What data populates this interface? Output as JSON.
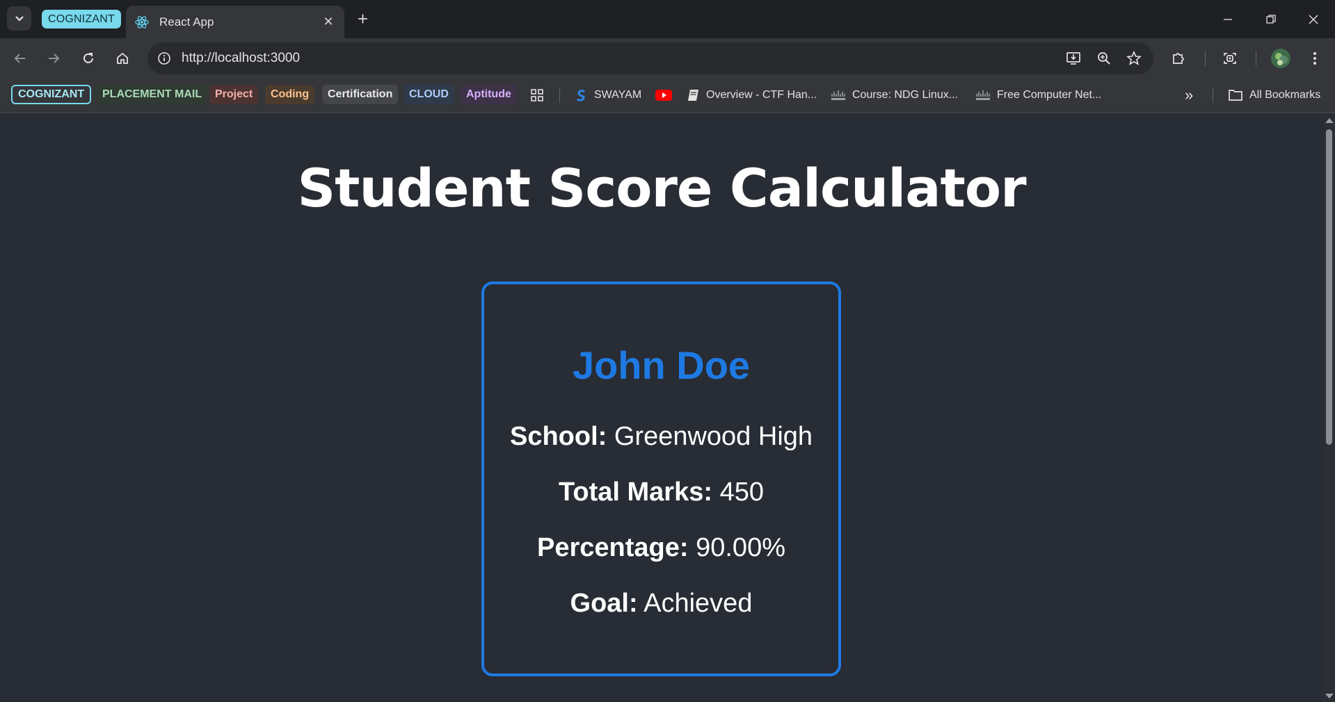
{
  "tab_group": {
    "label": "COGNIZANT"
  },
  "tab": {
    "title": "React App",
    "close": "✕"
  },
  "new_tab": "+",
  "address_bar": {
    "url": "http://localhost:3000"
  },
  "bookmarks": {
    "chips": [
      {
        "label": "COGNIZANT",
        "color": "#78d9ec"
      },
      {
        "label": "PLACEMENT MAIL",
        "color": "#a8dab5"
      },
      {
        "label": "Project",
        "color": "#f28b82"
      },
      {
        "label": "Coding",
        "color": "#fcad70"
      },
      {
        "label": "Certification",
        "color": "#dadce0"
      },
      {
        "label": "CLOUD",
        "color": "#8ab4f8"
      },
      {
        "label": "Aptitude",
        "color": "#c58af9"
      }
    ],
    "links": [
      {
        "label": "SWAYAM"
      },
      {
        "label": ""
      },
      {
        "label": "Overview - CTF Han..."
      },
      {
        "label": "Course: NDG Linux..."
      },
      {
        "label": "Free Computer Net..."
      }
    ],
    "overflow": "»",
    "all_bookmarks": "All Bookmarks"
  },
  "page": {
    "heading": "Student Score Calculator",
    "student": {
      "name": "John Doe",
      "school_label": "School:",
      "school": "Greenwood High",
      "total_label": "Total Marks:",
      "total": "450",
      "percentage_label": "Percentage:",
      "percentage": "90.00%",
      "goal_label": "Goal:",
      "goal": "Achieved"
    }
  },
  "colors": {
    "page_bg": "#282c34",
    "accent": "#1e7ae3",
    "text": "#ffffff"
  }
}
